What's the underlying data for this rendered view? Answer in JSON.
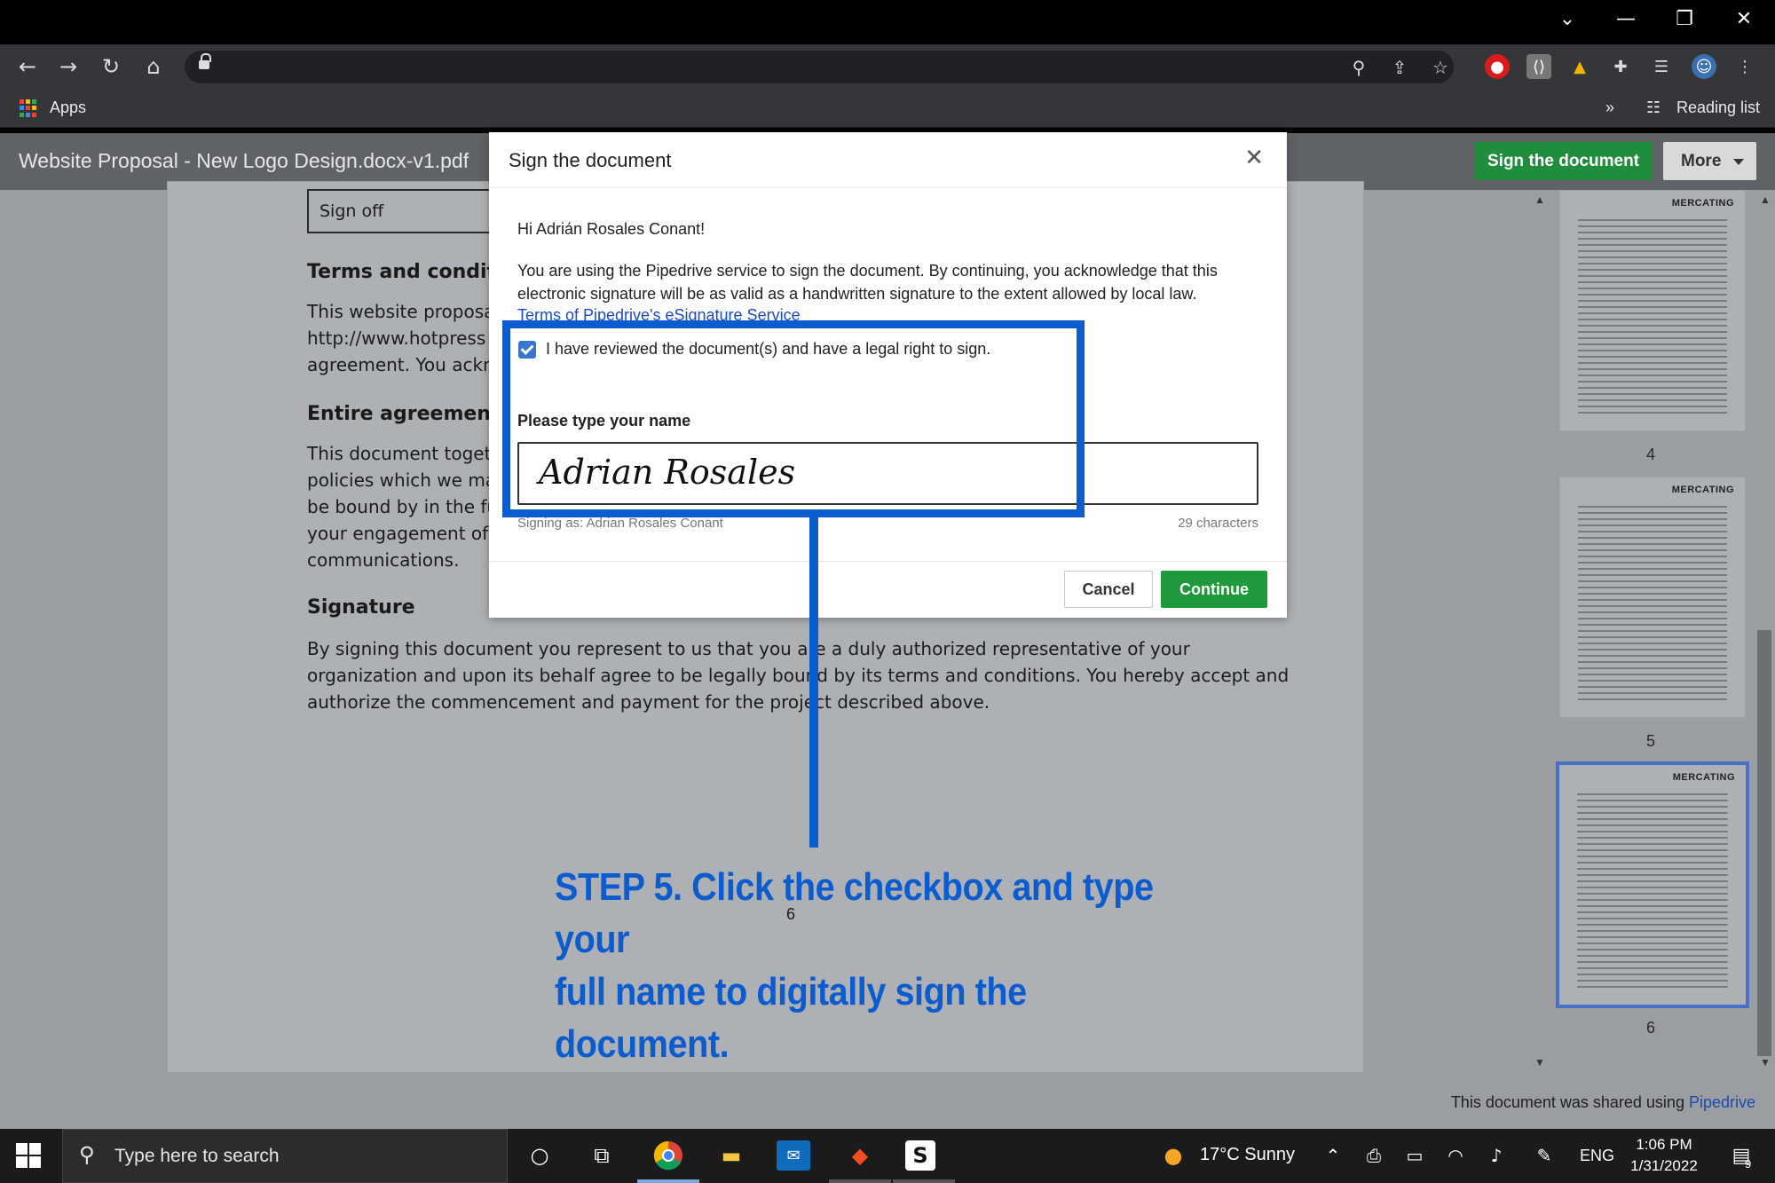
{
  "browser": {
    "bookmarks": {
      "apps_label": "Apps",
      "overflow": "»",
      "reading_list_label": "Reading list"
    },
    "window_controls": {
      "chevron": "⌄",
      "minimize": "—",
      "restore": "❐",
      "close": "✕"
    }
  },
  "doc_header": {
    "title": "Website Proposal - New Logo Design.docx-v1.pdf",
    "sign_button": "Sign the document",
    "more_button": "More"
  },
  "document": {
    "signoff_label": "Sign off",
    "terms_heading": "Terms and conditio",
    "terms_text": "This website proposa\nhttp://www.hotpress\nagreement. You ackn",
    "entire_heading": "Entire agreement",
    "entire_text": "This document toget\npolicies which we ma\nbe bound by in the fu\nyour engagement of\ncommunications.",
    "signature_heading": "Signature",
    "signature_text": "By signing this document you represent to us that you are a duly authorized representative of your\norganization and upon its behalf agree to be legally bound by its terms and conditions. You hereby accept and\nauthorize the commencement and payment for the project described above.",
    "page_number": "6"
  },
  "thumbnails": [
    {
      "logo": "MERCATING",
      "number": "4"
    },
    {
      "logo": "MERCATING",
      "number": "5"
    },
    {
      "logo": "MERCATING",
      "number": "6"
    }
  ],
  "footer": {
    "text": "This document was shared using ",
    "link": "Pipedrive"
  },
  "modal": {
    "title": "Sign the document",
    "greeting": "Hi Adrián Rosales Conant!",
    "consent_text": "You are using the Pipedrive service to sign the document. By continuing, you acknowledge that this\nelectronic signature will be as valid as a handwritten signature to the extent allowed by local law.",
    "terms_link": "Terms of Pipedrive's eSignature Service",
    "checkbox_label": "I have reviewed the document(s) and have a legal right to sign.",
    "checkbox_checked": true,
    "name_label": "Please type your name",
    "name_value": "Adrian Rosales",
    "signing_as": "Signing as: Adrian Rosales Conant",
    "char_count": "29 characters",
    "cancel": "Cancel",
    "continue": "Continue"
  },
  "annotation": {
    "step_line1": "STEP 5. Click the checkbox and type your",
    "step_line2": "full name to digitally sign the document.",
    "color": "#0a5ccf"
  },
  "taskbar": {
    "search_placeholder": "Type here to search",
    "weather": "17°C  Sunny",
    "language": "ENG",
    "time": "1:06 PM",
    "date": "1/31/2022",
    "notification_count": "9"
  },
  "colors": {
    "accent_green": "#1f8d3b",
    "link_blue": "#1a4cc6"
  }
}
